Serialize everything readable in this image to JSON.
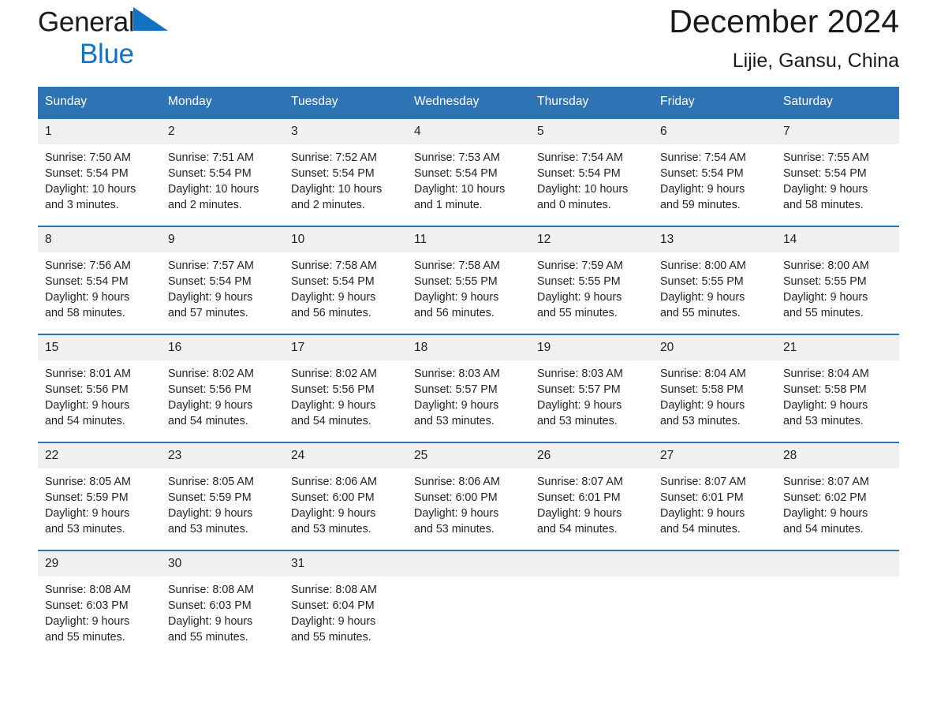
{
  "brand": {
    "word1": "General",
    "word2": "Blue",
    "triangle_color": "#1273c4",
    "word2_color": "#1273c4",
    "word1_color": "#1a1a1a"
  },
  "header": {
    "title": "December 2024",
    "subtitle": "Lijie, Gansu, China",
    "accent_color": "#2e74b5",
    "daynum_band_color": "#f0f0f0"
  },
  "calendar": {
    "weekday_headers": [
      "Sunday",
      "Monday",
      "Tuesday",
      "Wednesday",
      "Thursday",
      "Friday",
      "Saturday"
    ],
    "weeks": [
      [
        {
          "day": "1",
          "sunrise": "Sunrise: 7:50 AM",
          "sunset": "Sunset: 5:54 PM",
          "daylight_line1": "Daylight: 10 hours",
          "daylight_line2": "and 3 minutes."
        },
        {
          "day": "2",
          "sunrise": "Sunrise: 7:51 AM",
          "sunset": "Sunset: 5:54 PM",
          "daylight_line1": "Daylight: 10 hours",
          "daylight_line2": "and 2 minutes."
        },
        {
          "day": "3",
          "sunrise": "Sunrise: 7:52 AM",
          "sunset": "Sunset: 5:54 PM",
          "daylight_line1": "Daylight: 10 hours",
          "daylight_line2": "and 2 minutes."
        },
        {
          "day": "4",
          "sunrise": "Sunrise: 7:53 AM",
          "sunset": "Sunset: 5:54 PM",
          "daylight_line1": "Daylight: 10 hours",
          "daylight_line2": "and 1 minute."
        },
        {
          "day": "5",
          "sunrise": "Sunrise: 7:54 AM",
          "sunset": "Sunset: 5:54 PM",
          "daylight_line1": "Daylight: 10 hours",
          "daylight_line2": "and 0 minutes."
        },
        {
          "day": "6",
          "sunrise": "Sunrise: 7:54 AM",
          "sunset": "Sunset: 5:54 PM",
          "daylight_line1": "Daylight: 9 hours",
          "daylight_line2": "and 59 minutes."
        },
        {
          "day": "7",
          "sunrise": "Sunrise: 7:55 AM",
          "sunset": "Sunset: 5:54 PM",
          "daylight_line1": "Daylight: 9 hours",
          "daylight_line2": "and 58 minutes."
        }
      ],
      [
        {
          "day": "8",
          "sunrise": "Sunrise: 7:56 AM",
          "sunset": "Sunset: 5:54 PM",
          "daylight_line1": "Daylight: 9 hours",
          "daylight_line2": "and 58 minutes."
        },
        {
          "day": "9",
          "sunrise": "Sunrise: 7:57 AM",
          "sunset": "Sunset: 5:54 PM",
          "daylight_line1": "Daylight: 9 hours",
          "daylight_line2": "and 57 minutes."
        },
        {
          "day": "10",
          "sunrise": "Sunrise: 7:58 AM",
          "sunset": "Sunset: 5:54 PM",
          "daylight_line1": "Daylight: 9 hours",
          "daylight_line2": "and 56 minutes."
        },
        {
          "day": "11",
          "sunrise": "Sunrise: 7:58 AM",
          "sunset": "Sunset: 5:55 PM",
          "daylight_line1": "Daylight: 9 hours",
          "daylight_line2": "and 56 minutes."
        },
        {
          "day": "12",
          "sunrise": "Sunrise: 7:59 AM",
          "sunset": "Sunset: 5:55 PM",
          "daylight_line1": "Daylight: 9 hours",
          "daylight_line2": "and 55 minutes."
        },
        {
          "day": "13",
          "sunrise": "Sunrise: 8:00 AM",
          "sunset": "Sunset: 5:55 PM",
          "daylight_line1": "Daylight: 9 hours",
          "daylight_line2": "and 55 minutes."
        },
        {
          "day": "14",
          "sunrise": "Sunrise: 8:00 AM",
          "sunset": "Sunset: 5:55 PM",
          "daylight_line1": "Daylight: 9 hours",
          "daylight_line2": "and 55 minutes."
        }
      ],
      [
        {
          "day": "15",
          "sunrise": "Sunrise: 8:01 AM",
          "sunset": "Sunset: 5:56 PM",
          "daylight_line1": "Daylight: 9 hours",
          "daylight_line2": "and 54 minutes."
        },
        {
          "day": "16",
          "sunrise": "Sunrise: 8:02 AM",
          "sunset": "Sunset: 5:56 PM",
          "daylight_line1": "Daylight: 9 hours",
          "daylight_line2": "and 54 minutes."
        },
        {
          "day": "17",
          "sunrise": "Sunrise: 8:02 AM",
          "sunset": "Sunset: 5:56 PM",
          "daylight_line1": "Daylight: 9 hours",
          "daylight_line2": "and 54 minutes."
        },
        {
          "day": "18",
          "sunrise": "Sunrise: 8:03 AM",
          "sunset": "Sunset: 5:57 PM",
          "daylight_line1": "Daylight: 9 hours",
          "daylight_line2": "and 53 minutes."
        },
        {
          "day": "19",
          "sunrise": "Sunrise: 8:03 AM",
          "sunset": "Sunset: 5:57 PM",
          "daylight_line1": "Daylight: 9 hours",
          "daylight_line2": "and 53 minutes."
        },
        {
          "day": "20",
          "sunrise": "Sunrise: 8:04 AM",
          "sunset": "Sunset: 5:58 PM",
          "daylight_line1": "Daylight: 9 hours",
          "daylight_line2": "and 53 minutes."
        },
        {
          "day": "21",
          "sunrise": "Sunrise: 8:04 AM",
          "sunset": "Sunset: 5:58 PM",
          "daylight_line1": "Daylight: 9 hours",
          "daylight_line2": "and 53 minutes."
        }
      ],
      [
        {
          "day": "22",
          "sunrise": "Sunrise: 8:05 AM",
          "sunset": "Sunset: 5:59 PM",
          "daylight_line1": "Daylight: 9 hours",
          "daylight_line2": "and 53 minutes."
        },
        {
          "day": "23",
          "sunrise": "Sunrise: 8:05 AM",
          "sunset": "Sunset: 5:59 PM",
          "daylight_line1": "Daylight: 9 hours",
          "daylight_line2": "and 53 minutes."
        },
        {
          "day": "24",
          "sunrise": "Sunrise: 8:06 AM",
          "sunset": "Sunset: 6:00 PM",
          "daylight_line1": "Daylight: 9 hours",
          "daylight_line2": "and 53 minutes."
        },
        {
          "day": "25",
          "sunrise": "Sunrise: 8:06 AM",
          "sunset": "Sunset: 6:00 PM",
          "daylight_line1": "Daylight: 9 hours",
          "daylight_line2": "and 53 minutes."
        },
        {
          "day": "26",
          "sunrise": "Sunrise: 8:07 AM",
          "sunset": "Sunset: 6:01 PM",
          "daylight_line1": "Daylight: 9 hours",
          "daylight_line2": "and 54 minutes."
        },
        {
          "day": "27",
          "sunrise": "Sunrise: 8:07 AM",
          "sunset": "Sunset: 6:01 PM",
          "daylight_line1": "Daylight: 9 hours",
          "daylight_line2": "and 54 minutes."
        },
        {
          "day": "28",
          "sunrise": "Sunrise: 8:07 AM",
          "sunset": "Sunset: 6:02 PM",
          "daylight_line1": "Daylight: 9 hours",
          "daylight_line2": "and 54 minutes."
        }
      ],
      [
        {
          "day": "29",
          "sunrise": "Sunrise: 8:08 AM",
          "sunset": "Sunset: 6:03 PM",
          "daylight_line1": "Daylight: 9 hours",
          "daylight_line2": "and 55 minutes."
        },
        {
          "day": "30",
          "sunrise": "Sunrise: 8:08 AM",
          "sunset": "Sunset: 6:03 PM",
          "daylight_line1": "Daylight: 9 hours",
          "daylight_line2": "and 55 minutes."
        },
        {
          "day": "31",
          "sunrise": "Sunrise: 8:08 AM",
          "sunset": "Sunset: 6:04 PM",
          "daylight_line1": "Daylight: 9 hours",
          "daylight_line2": "and 55 minutes."
        },
        {
          "day": "",
          "sunrise": "",
          "sunset": "",
          "daylight_line1": "",
          "daylight_line2": ""
        },
        {
          "day": "",
          "sunrise": "",
          "sunset": "",
          "daylight_line1": "",
          "daylight_line2": ""
        },
        {
          "day": "",
          "sunrise": "",
          "sunset": "",
          "daylight_line1": "",
          "daylight_line2": ""
        },
        {
          "day": "",
          "sunrise": "",
          "sunset": "",
          "daylight_line1": "",
          "daylight_line2": ""
        }
      ]
    ]
  }
}
